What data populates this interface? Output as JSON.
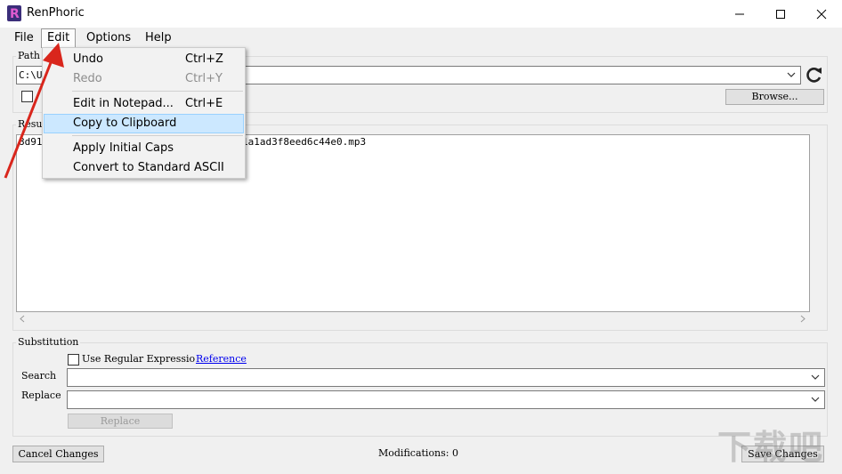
{
  "window": {
    "title": "RenPhoric",
    "controls": {
      "minimize": "—",
      "maximize": "□",
      "close": "✕"
    }
  },
  "menubar": [
    "File",
    "Edit",
    "Options",
    "Help"
  ],
  "edit_menu": {
    "items": [
      {
        "label": "Undo",
        "shortcut": "Ctrl+Z",
        "enabled": true
      },
      {
        "label": "Redo",
        "shortcut": "Ctrl+Y",
        "enabled": false
      },
      {
        "label": "Edit in Notepad...",
        "shortcut": "Ctrl+E",
        "enabled": true
      },
      {
        "label": "Copy to Clipboard",
        "shortcut": "",
        "enabled": true,
        "highlighted": true
      },
      {
        "label": "Apply Initial Caps",
        "shortcut": "",
        "enabled": true
      },
      {
        "label": "Convert to Standard ASCII",
        "shortcut": "",
        "enabled": true
      }
    ]
  },
  "path_group": {
    "label": "Path",
    "value": "C:\\U",
    "browse_label": "Browse...",
    "checkbox_checked": false
  },
  "results_group": {
    "label": "Resu",
    "line_prefix": "8d91",
    "line_suffix": "1a1ad3f8eed6c44e0.mp3"
  },
  "substitution": {
    "label": "Substitution",
    "regex_label": "Use Regular Expressio",
    "regex_checked": false,
    "reference_link": "Reference",
    "search_label": "Search",
    "search_value": "",
    "replace_label": "Replace",
    "replace_value": "",
    "replace_button": "Replace"
  },
  "footer": {
    "cancel_label": "Cancel Changes",
    "modifications_label": "Modifications: 0",
    "save_label": "Save Changes"
  },
  "watermark": "下载吧",
  "colors": {
    "annotation_arrow": "#d9261c",
    "menu_highlight": "#cce8ff",
    "link": "#0000ee"
  }
}
